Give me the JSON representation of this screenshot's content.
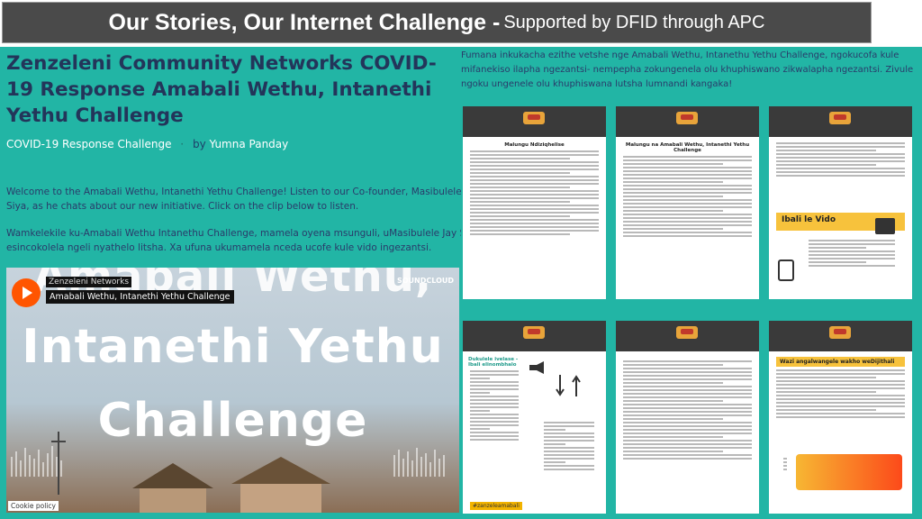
{
  "banner": {
    "title": "Our Stories, Our Internet Challenge -",
    "subtitle": "Supported by DFID through APC"
  },
  "post": {
    "title": "Zenzeleni Community Networks COVID-19 Response Amabali Wethu, Intanethi Yethu Challenge",
    "category": "COVID-19 Response Challenge",
    "separator": "·",
    "by": "by",
    "author": "Yumna Panday",
    "para1_line1": "Welcome to the Amabali Wethu, Intanethi Yethu Challenge! Listen to our Co-founder, Masibulele Ja",
    "para1_line2": "Siya, as he chats about our new initiative. Click on the clip below to listen.",
    "para2_line1": "Wamkelekile ku-Amabali Wethu Intanethu Challenge, mamela oyena msunguli, uMasibulele Jay Siya, x",
    "para2_line2": "esincokolela ngeli nyathelo litsha. Xa ufuna ukumamela nceda ucofe kule vido ingezantsi."
  },
  "player": {
    "artist": "Zenzeleni Networks",
    "track": "Amabali Wethu, Intanethi Yethu Challenge",
    "brand": "SOUNDCLOUD",
    "big_line1": "Amabali Wethu,",
    "big_line2": "Intanethi Yethu",
    "big_line3": "Challenge",
    "cookie": "Cookie policy"
  },
  "right": {
    "paragraph": "Fumana inkukacha ezithe vetshe nge Amabali Wethu, Intanethu Yethu Challenge, ngokucofa kule mifanekiso ilapha ngezantsi- nempepha zokungenela olu khuphiswano zikwalapha ngezantsi. Zivule ngoku ungenele olu khuphiswana lutsha lumnandi kangaka!",
    "thumbs": [
      {
        "heading": "Malungu Ndiziqhelise"
      },
      {
        "heading": "Malungu na Amabali Wethu, Intanethi Yethu Challenge"
      },
      {
        "heading": "",
        "video_label": "Ibali le Vido"
      },
      {
        "heading": "Dukulele ivelase - Ibali elinombhalo"
      },
      {
        "heading": ""
      },
      {
        "heading": "Wazi angalwangele wakho weDijithali"
      }
    ],
    "tag_label": "#zanzeleamabali"
  },
  "colors": {
    "teal": "#22b5a5",
    "navy": "#23355a",
    "banner": "#4a4a4a",
    "soundcloud": "#ff5500"
  }
}
